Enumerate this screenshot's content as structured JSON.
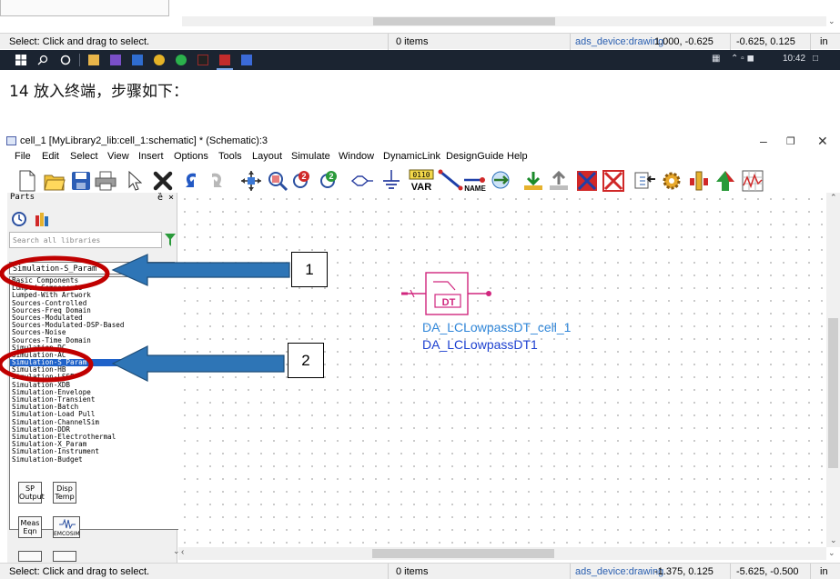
{
  "top": {
    "status_left": "Select: Click and drag to select.",
    "items": "0 items",
    "device": "ads_device:drawing",
    "coord1": "1.000, -0.625",
    "coord2": "-0.625, 0.125",
    "unit": "in"
  },
  "taskbar": {
    "time": "10:42"
  },
  "instruction": "14 放入终端，步骤如下：",
  "window": {
    "title": "cell_1 [MyLibrary2_lib:cell_1:schematic] * (Schematic):3",
    "menu": [
      "File",
      "Edit",
      "Select",
      "View",
      "Insert",
      "Options",
      "Tools",
      "Layout",
      "Simulate",
      "Window",
      "DynamicLink",
      "DesignGuide",
      "Help"
    ]
  },
  "toolbar": {
    "var_label": "VAR",
    "var_bits": "0110",
    "name_label": "NAME"
  },
  "parts": {
    "title": "Parts",
    "pin": "ȅ ×",
    "search_placeholder": "Search all libraries",
    "combo_value": "Simulation-S_Param",
    "list": [
      "Basic Components",
      "Lumped-Components",
      "Lumped-With Artwork",
      "Sources-Controlled",
      "Sources-Freq Domain",
      "Sources-Modulated",
      "Sources-Modulated-DSP-Based",
      "Sources-Noise",
      "Sources-Time Domain",
      "Simulation-DC",
      "Simulation-AC",
      "Simulation-S_Param",
      "Simulation-HB",
      "Simulation-LSSP",
      "Simulation-XDB",
      "Simulation-Envelope",
      "Simulation-Transient",
      "Simulation-Batch",
      "Simulation-Load Pull",
      "Simulation-ChannelSim",
      "Simulation-DDR",
      "Simulation-Electrothermal",
      "Simulation-X_Param",
      "Simulation-Instrument",
      "Simulation-Budget"
    ],
    "selected_index": 11,
    "palette": [
      {
        "line1": "SP",
        "line2": "Output"
      },
      {
        "line1": "Disp",
        "line2": "Temp"
      },
      {
        "line1": "Meas",
        "line2": "Eqn"
      },
      {
        "line1": "",
        "line2": "EMCOSIM"
      }
    ]
  },
  "component": {
    "label": "DT",
    "name1": "DA_LCLowpassDT_cell_1",
    "name2": "DA_LCLowpassDT1"
  },
  "callouts": {
    "c1": "1",
    "c2": "2"
  },
  "bottom": {
    "status_left": "Select: Click and drag to select.",
    "items": "0 items",
    "device": "ads_device:drawing",
    "coord1": "-1.375, 0.125",
    "coord2": "-5.625, -0.500",
    "unit": "in"
  },
  "colors": {
    "accent_blue": "#2e75b6",
    "highlight_red": "#c00000",
    "schematic_pink": "#d0267e",
    "schematic_blue": "#1f54d6"
  }
}
